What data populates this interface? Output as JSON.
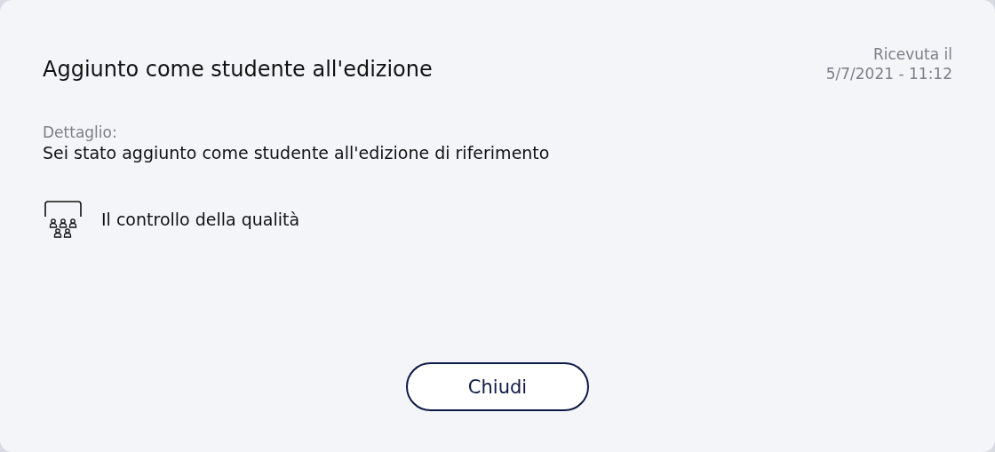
{
  "dialog": {
    "title": "Aggiunto come studente all'edizione",
    "received": {
      "label": "Ricevuta il",
      "datetime": "5/7/2021 - 11:12"
    },
    "detail": {
      "label": "Dettaglio:",
      "text": "Sei stato aggiunto come studente all'edizione di riferimento"
    },
    "course": {
      "name": "Il controllo della qualità"
    },
    "buttons": [
      "Chiudi"
    ]
  }
}
